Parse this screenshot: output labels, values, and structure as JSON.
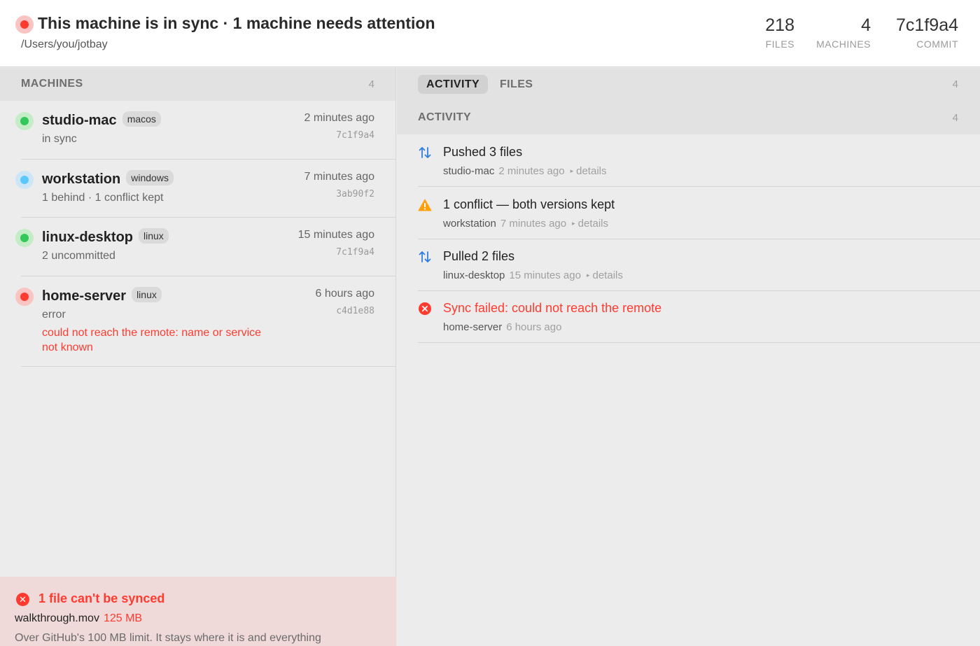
{
  "header": {
    "title": "This machine is in sync · 1 machine needs attention",
    "path": "/Users/you/jotbay",
    "stats": {
      "files": {
        "value": "218",
        "label": "FILES"
      },
      "machines": {
        "value": "4",
        "label": "MACHINES"
      },
      "commit": {
        "value": "7c1f9a4",
        "label": "COMMIT"
      }
    },
    "status_color": "#ff3b30"
  },
  "machines": {
    "title": "MACHINES",
    "count": "4",
    "items": [
      {
        "name": "studio-mac",
        "os": "macos",
        "status": "in sync",
        "error": "",
        "time": "2 minutes ago",
        "commit": "7c1f9a4",
        "color": "green"
      },
      {
        "name": "workstation",
        "os": "windows",
        "status": "1 behind · 1 conflict kept",
        "error": "",
        "time": "7 minutes ago",
        "commit": "3ab90f2",
        "color": "blue"
      },
      {
        "name": "linux-desktop",
        "os": "linux",
        "status": "2 uncommitted",
        "error": "",
        "time": "15 minutes ago",
        "commit": "7c1f9a4",
        "color": "green"
      },
      {
        "name": "home-server",
        "os": "linux",
        "status": "error",
        "error": "could not reach the remote: name or service not known",
        "time": "6 hours ago",
        "commit": "c4d1e88",
        "color": "red"
      }
    ]
  },
  "unsynced": {
    "title": "1 file can't be synced",
    "file": "walkthrough.mov",
    "size": "125 MB",
    "description": "Over GitHub's 100 MB limit. It stays where it is and everything"
  },
  "tabs": {
    "activity": "ACTIVITY",
    "files": "FILES",
    "count": "4"
  },
  "activity": {
    "title": "ACTIVITY",
    "count": "4",
    "events": [
      {
        "icon": "sync-arrows-icon",
        "title": "Pushed 3 files",
        "machine": "studio-mac",
        "time": "2 minutes ago",
        "details": "details",
        "type": "normal"
      },
      {
        "icon": "warning-icon",
        "title": "1 conflict — both versions kept",
        "machine": "workstation",
        "time": "7 minutes ago",
        "details": "details",
        "type": "normal"
      },
      {
        "icon": "sync-arrows-icon",
        "title": "Pulled 2 files",
        "machine": "linux-desktop",
        "time": "15 minutes ago",
        "details": "details",
        "type": "normal"
      },
      {
        "icon": "error-icon",
        "title": "Sync failed: could not reach the remote",
        "machine": "home-server",
        "time": "6 hours ago",
        "details": "",
        "type": "error"
      }
    ]
  },
  "colors": {
    "accent_blue": "#2f7ee6",
    "error_red": "#ff3b30",
    "warning_orange": "#ff9f0a",
    "ok_green": "#34c759"
  }
}
